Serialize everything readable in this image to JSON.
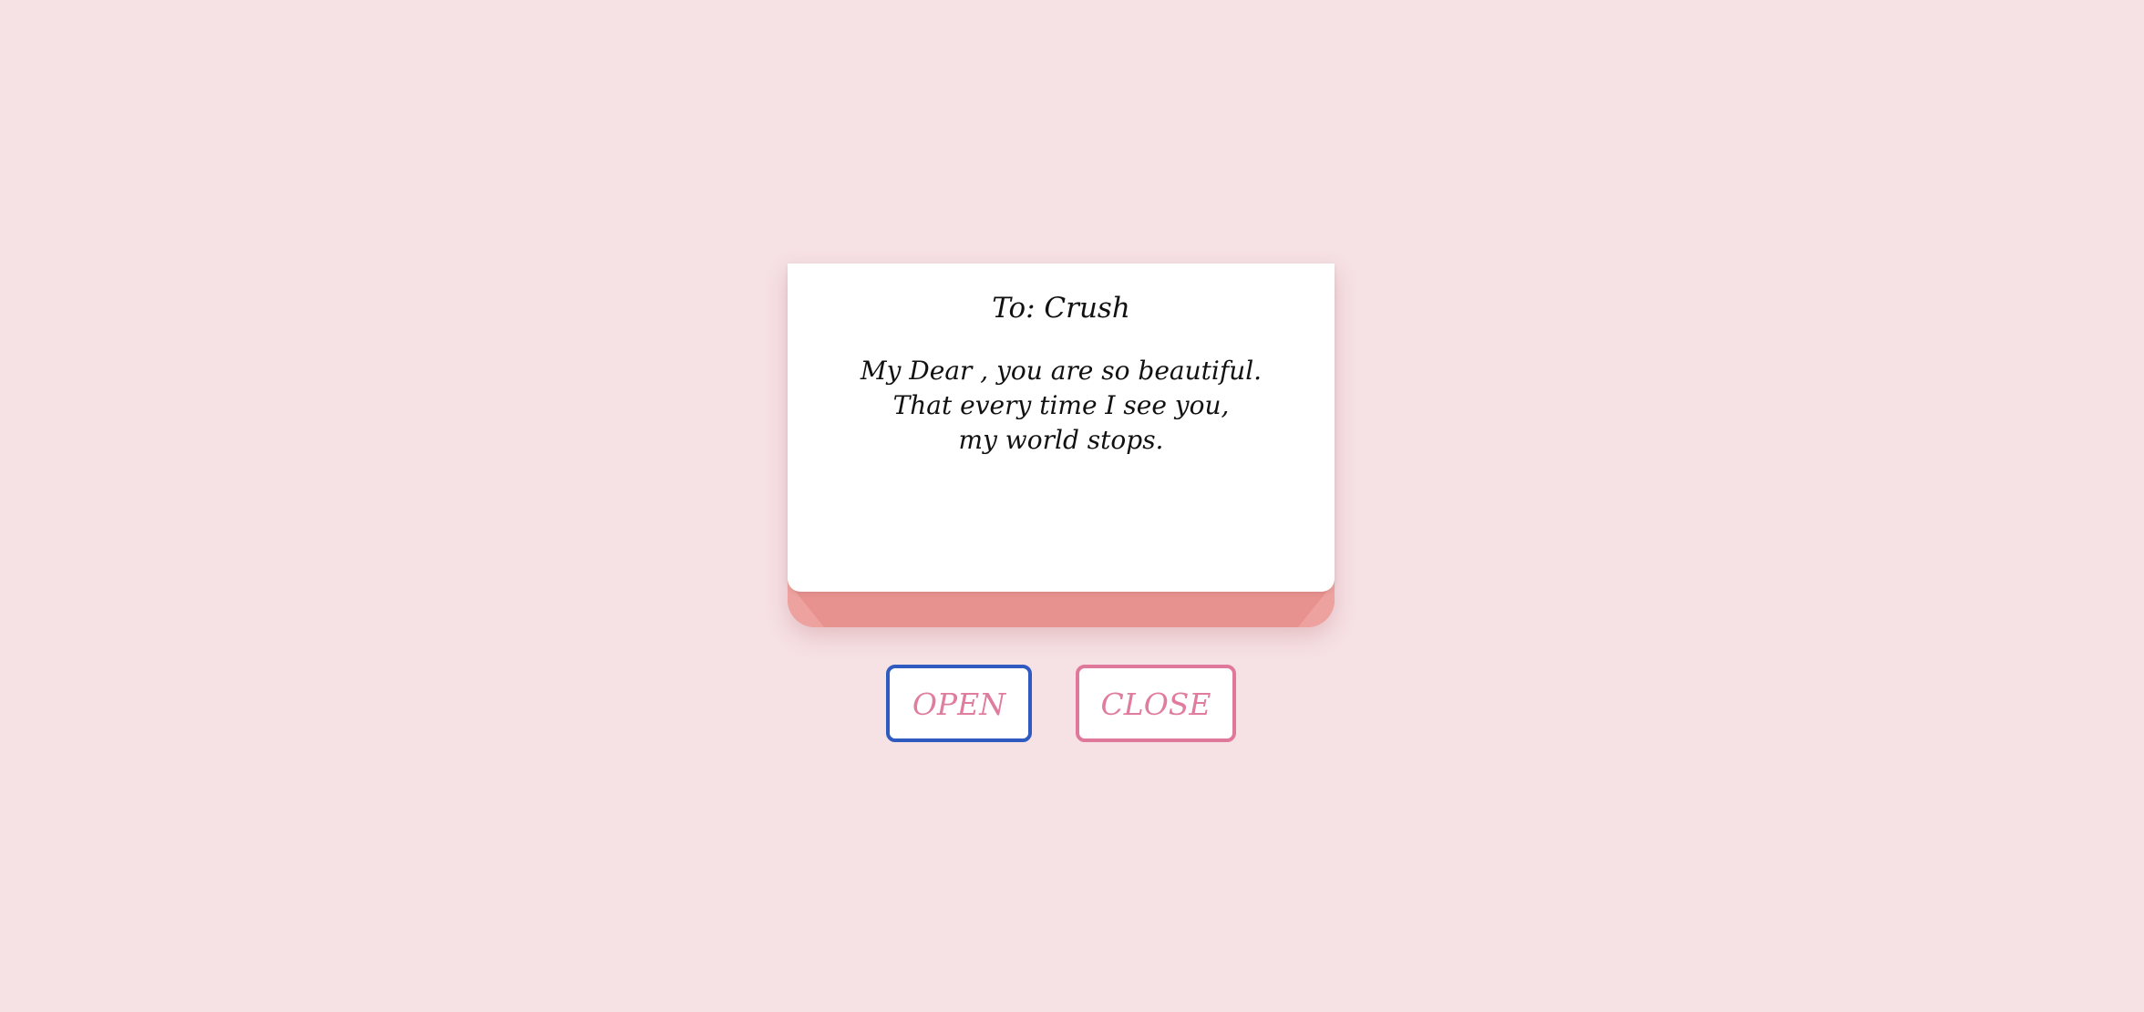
{
  "letter": {
    "to": "To: Crush",
    "lines": [
      "My Dear , you are so beautiful.",
      "That every time I see you,",
      "my world stops."
    ]
  },
  "buttons": {
    "open_label": "OPEN",
    "close_label": "CLOSE"
  },
  "colors": {
    "background": "#f6e1e4",
    "envelope": "#e8928f",
    "accent_text": "#e07c9e",
    "open_border": "#2f5bc0",
    "close_border": "#e0789b"
  }
}
